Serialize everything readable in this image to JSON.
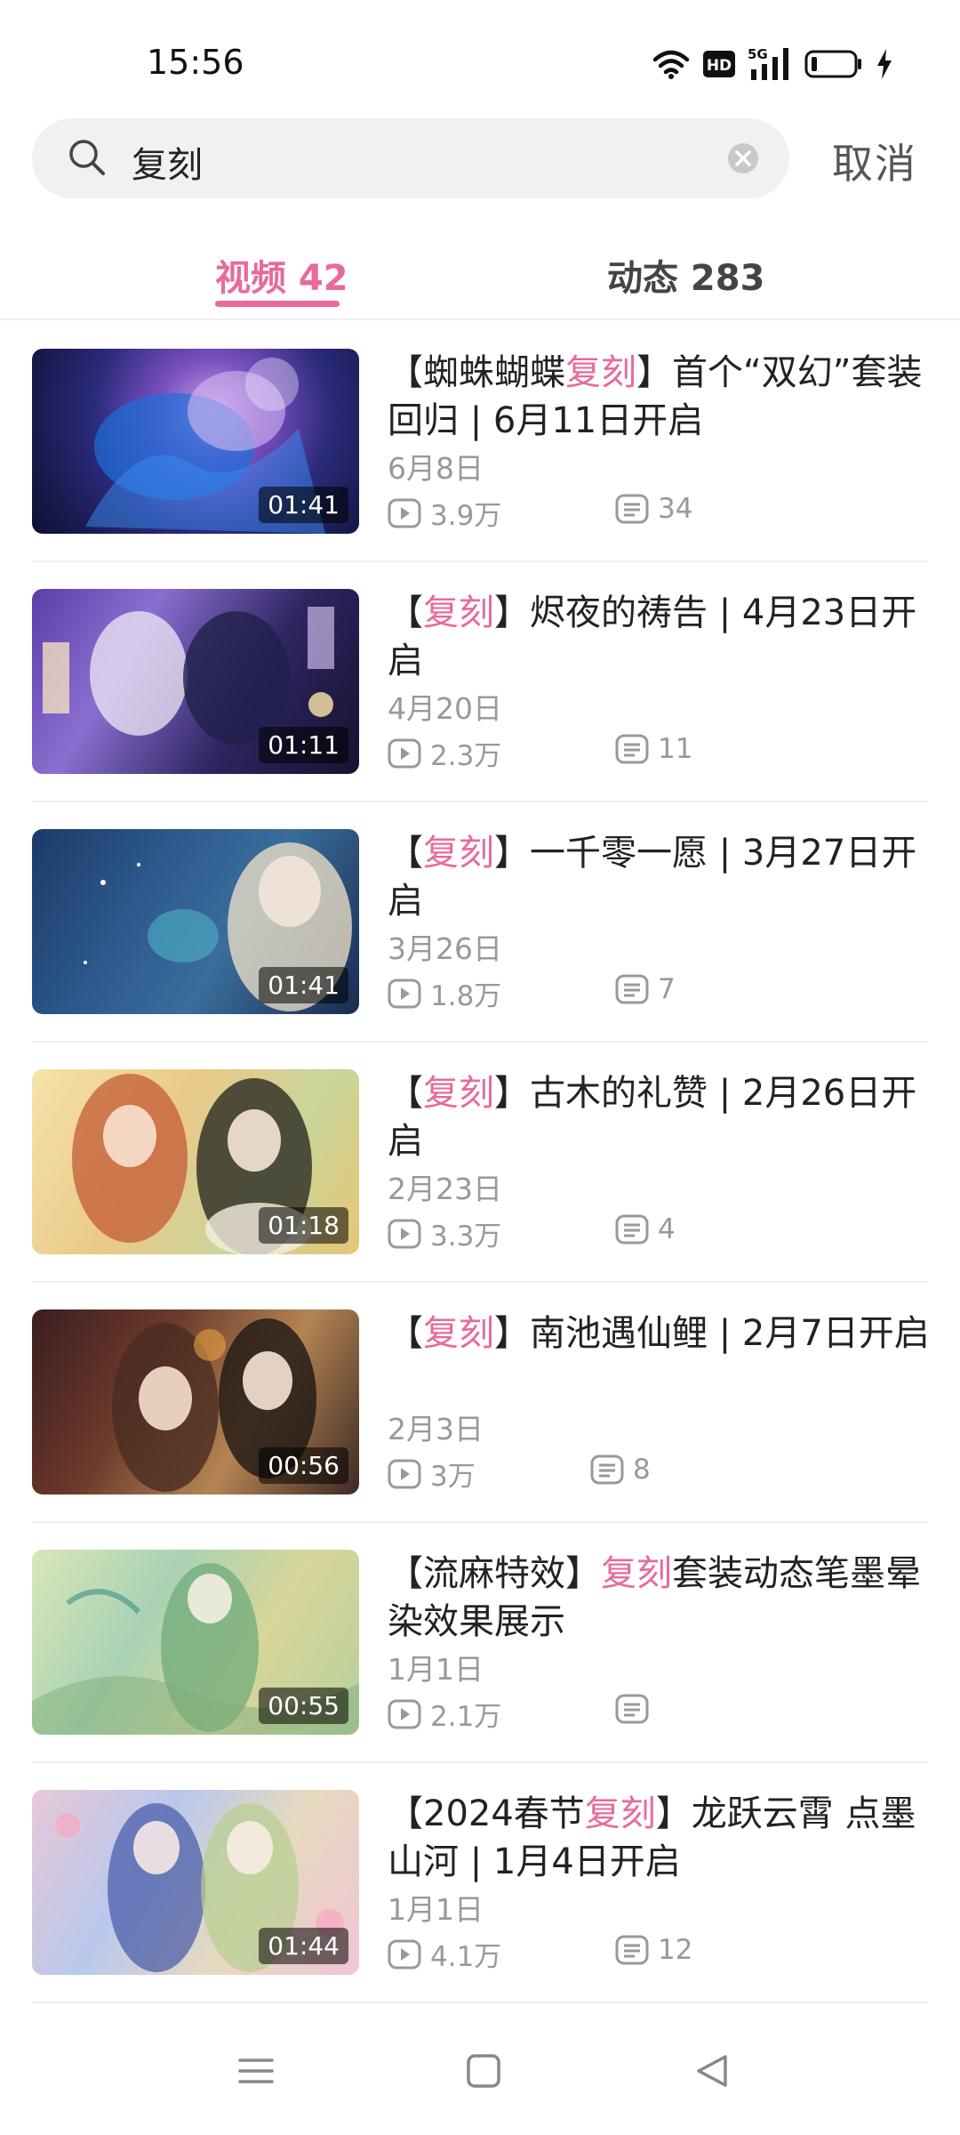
{
  "status_bar": {
    "time": "15:56",
    "icons": [
      "wifi-icon",
      "hd-icon",
      "5g-signal-icon",
      "battery-icon",
      "charging-icon"
    ],
    "hd_label": "HD",
    "network_label": "5G"
  },
  "search": {
    "query": "复刻",
    "cancel_label": "取消"
  },
  "tabs": [
    {
      "label": "视频 42",
      "active": true
    },
    {
      "label": "动态 283",
      "active": false
    }
  ],
  "accent_color": "#e86a9b",
  "results": [
    {
      "title_parts": [
        "【蜘蛛蝴蝶",
        "复刻",
        "】首个“双幻”套装回归 | 6月11日开启"
      ],
      "date": "6月8日",
      "views": "3.9万",
      "comments": "34",
      "duration": "01:41"
    },
    {
      "title_parts": [
        "【",
        "复刻",
        "】烬夜的祷告 | 4月23日开启"
      ],
      "date": "4月20日",
      "views": "2.3万",
      "comments": "11",
      "duration": "01:11"
    },
    {
      "title_parts": [
        "【",
        "复刻",
        "】一千零一愿 | 3月27日开启"
      ],
      "date": "3月26日",
      "views": "1.8万",
      "comments": "7",
      "duration": "01:41"
    },
    {
      "title_parts": [
        "【",
        "复刻",
        "】古木的礼赞 | 2月26日开启"
      ],
      "date": "2月23日",
      "views": "3.3万",
      "comments": "4",
      "duration": "01:18"
    },
    {
      "title_parts": [
        "【",
        "复刻",
        "】南池遇仙鲤 | 2月7日开启"
      ],
      "date": "2月3日",
      "views": "3万",
      "comments": "8",
      "duration": "00:56"
    },
    {
      "title_parts": [
        "【流麻特效】",
        "复刻",
        "套装动态笔墨晕染效果展示"
      ],
      "date": "1月1日",
      "views": "2.1万",
      "comments": "",
      "duration": "00:55"
    },
    {
      "title_parts": [
        "【2024春节",
        "复刻",
        "】龙跃云霄 点墨山河 | 1月4日开启"
      ],
      "date": "1月1日",
      "views": "4.1万",
      "comments": "12",
      "duration": "01:44"
    }
  ],
  "nav_bar": {
    "icons": [
      "menu-icon",
      "home-icon",
      "back-icon"
    ]
  }
}
